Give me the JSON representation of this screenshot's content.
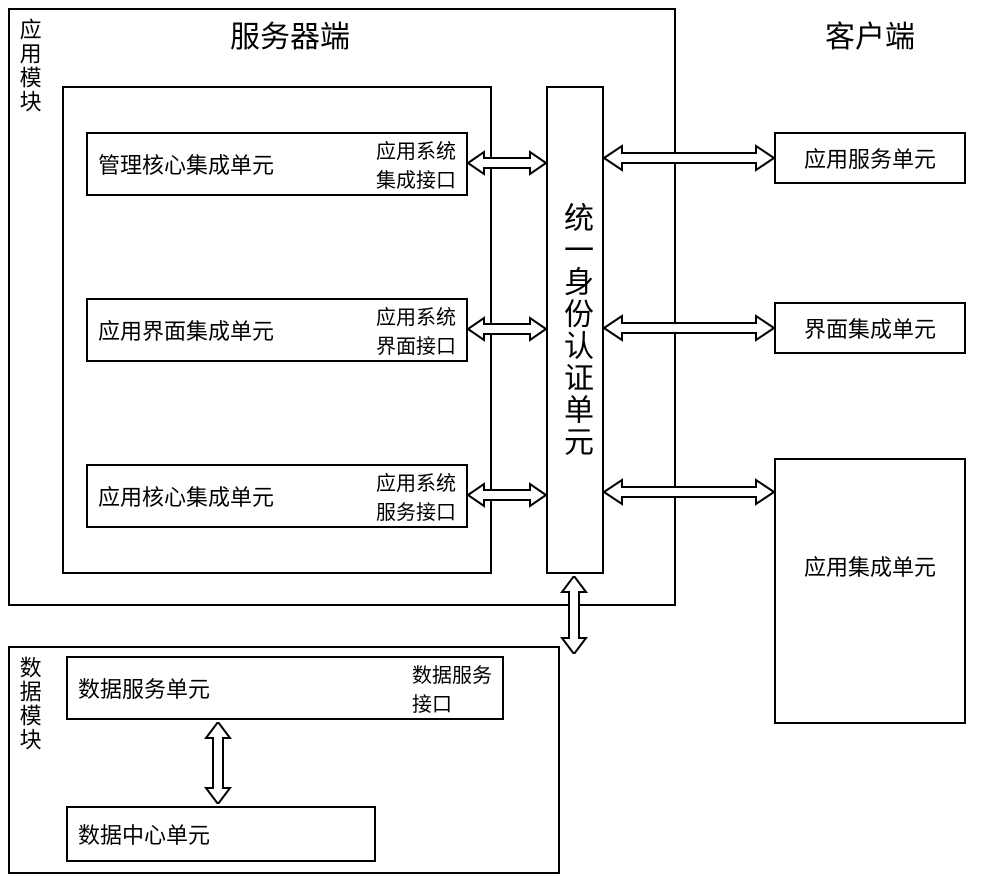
{
  "titles": {
    "server": "服务器端",
    "client": "客户端"
  },
  "sideLabels": {
    "appModule": "应用模块",
    "dataModule": "数据模块"
  },
  "server": {
    "unit1": "管理核心集成单元",
    "if1a": "应用系统",
    "if1b": "集成接口",
    "unit2": "应用界面集成单元",
    "if2a": "应用系统",
    "if2b": "界面接口",
    "unit3": "应用核心集成单元",
    "if3a": "应用系统",
    "if3b": "服务接口",
    "auth": "统一身份认证单元"
  },
  "client": {
    "box1": "应用服务单元",
    "box2": "界面集成单元",
    "box3": "应用集成单元"
  },
  "dataModule": {
    "unit1": "数据服务单元",
    "if1a": "数据服务",
    "if1b": "接口",
    "unit2": "数据中心单元"
  }
}
